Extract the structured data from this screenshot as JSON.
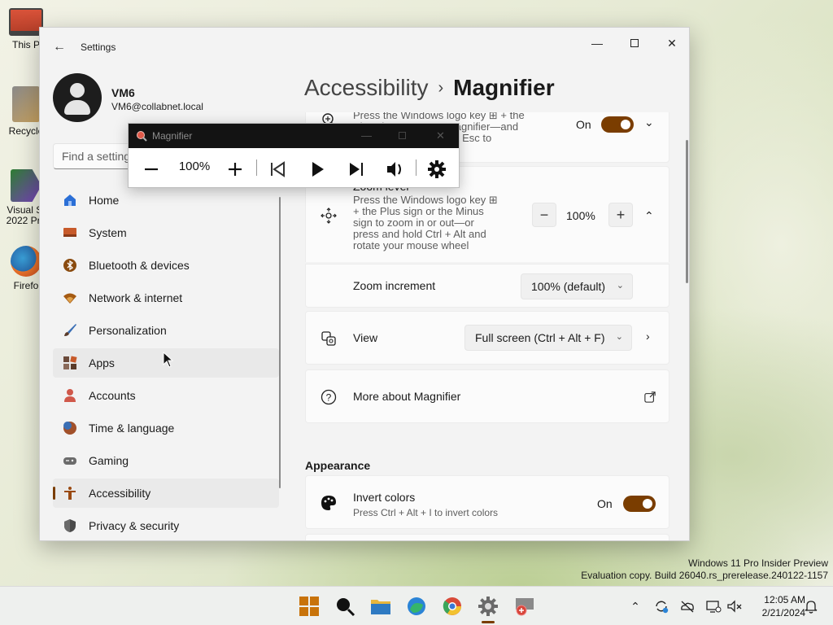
{
  "desktop": {
    "icons": [
      {
        "label": "This P"
      },
      {
        "label": "Recycle"
      },
      {
        "label": "Visual St\n2022 Pre"
      },
      {
        "label": "Firefo"
      }
    ]
  },
  "settings": {
    "app_title": "Settings",
    "user": {
      "name": "VM6",
      "email": "VM6@collabnet.local"
    },
    "search_placeholder": "Find a setting",
    "nav": [
      {
        "label": "Home",
        "icon": "home-icon"
      },
      {
        "label": "System",
        "icon": "system-icon"
      },
      {
        "label": "Bluetooth & devices",
        "icon": "bluetooth-icon"
      },
      {
        "label": "Network & internet",
        "icon": "network-icon"
      },
      {
        "label": "Personalization",
        "icon": "brush-icon"
      },
      {
        "label": "Apps",
        "icon": "apps-icon"
      },
      {
        "label": "Accounts",
        "icon": "accounts-icon"
      },
      {
        "label": "Time & language",
        "icon": "time-language-icon"
      },
      {
        "label": "Gaming",
        "icon": "gaming-icon"
      },
      {
        "label": "Accessibility",
        "icon": "accessibility-icon"
      },
      {
        "label": "Privacy & security",
        "icon": "shield-icon"
      }
    ],
    "breadcrumb": {
      "parent": "Accessibility",
      "separator": "›",
      "current": "Magnifier"
    },
    "magnifier_card": {
      "desc_line1": "Press the Windows logo key ⊞ + the",
      "desc_line2": "Plus sign to turn on Magnifier—and",
      "desc_line3": "Windows logo key ⊞ + Esc to",
      "state": "On"
    },
    "zoom_level": {
      "title": "Zoom level",
      "desc": [
        "Press the Windows logo key ⊞",
        "+ the Plus sign or the Minus",
        "sign to zoom in or out—or",
        "press and hold Ctrl + Alt and",
        "rotate your mouse wheel"
      ],
      "value": "100%",
      "minus": "−",
      "plus": "+"
    },
    "zoom_increment": {
      "title": "Zoom increment",
      "value": "100% (default)"
    },
    "view": {
      "title": "View",
      "value": "Full screen (Ctrl + Alt + F)"
    },
    "more": {
      "title": "More about Magnifier"
    },
    "appearance": {
      "heading": "Appearance"
    },
    "invert": {
      "title": "Invert colors",
      "desc": "Press Ctrl + Alt + I to invert colors",
      "state": "On"
    },
    "accent": "#7a3d00"
  },
  "magnifier_toolbar": {
    "title": "Magnifier",
    "zoom": "100%"
  },
  "watermark": {
    "line1": "Windows 11 Pro Insider Preview",
    "line2": "Evaluation copy. Build 26040.rs_prerelease.240122-1157"
  },
  "taskbar": {
    "time": "12:05 AM",
    "date": "2/21/2024"
  }
}
